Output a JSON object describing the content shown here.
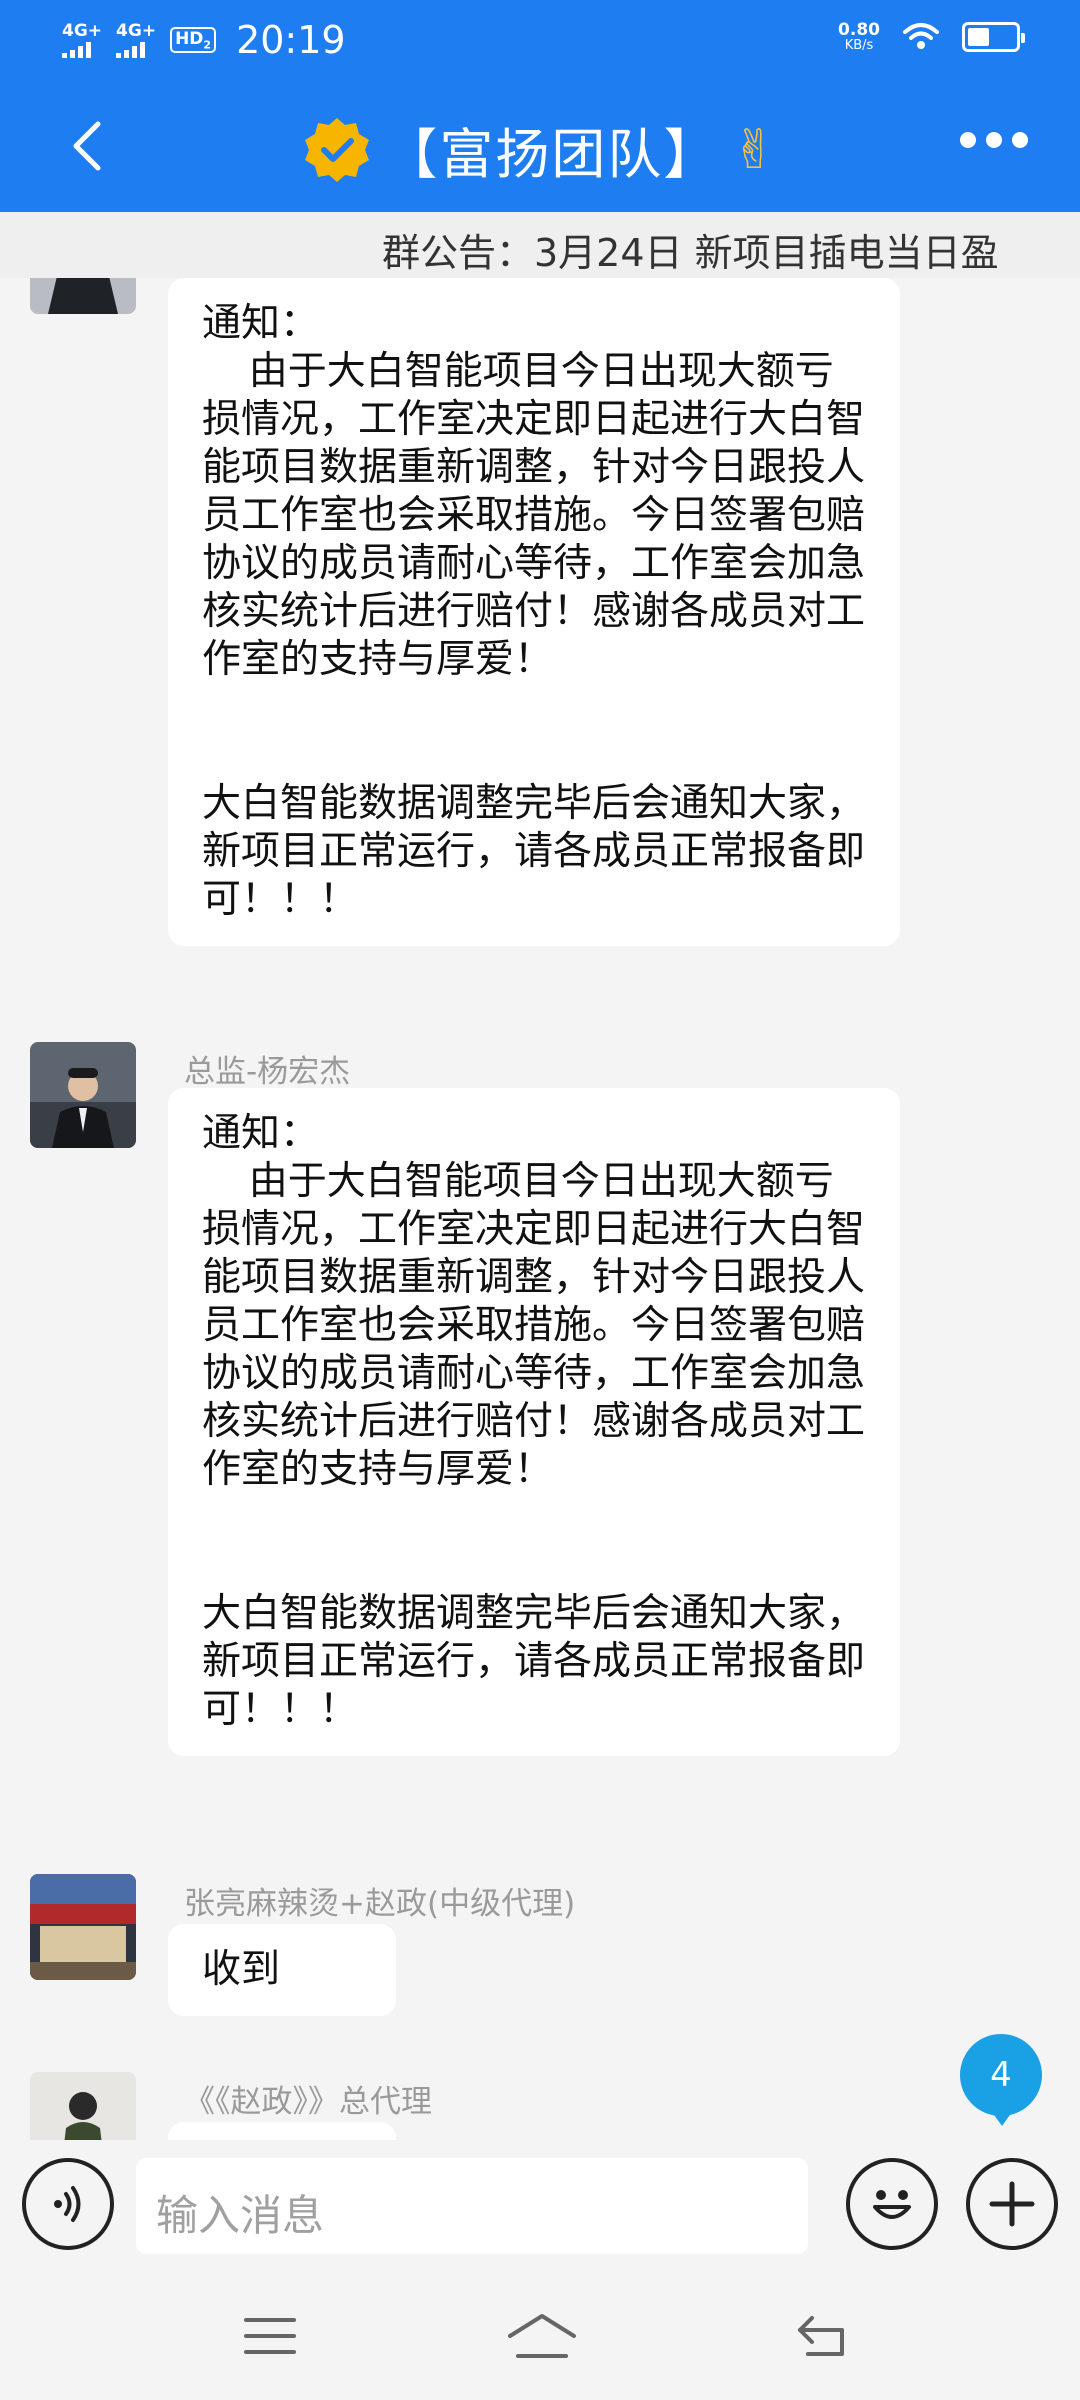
{
  "status_bar": {
    "network1": "4G+",
    "network2": "4G+",
    "hd_label": "HD",
    "hd_sub": "2",
    "time": "20:19",
    "speed_value": "0.80",
    "speed_unit": "KB/s",
    "battery_level": 0.4
  },
  "header": {
    "title": "【富扬团队】",
    "title_emoji": "✌",
    "icons": {
      "back": "back-arrow-icon",
      "badge": "verified-badge-icon",
      "more": "more-dots-icon"
    }
  },
  "announcement": "群公告：3月24日 新项目插电当日盈",
  "messages": [
    {
      "sender": "",
      "lines": [
        "通知：",
        "由于大白智能项目今日出现大额亏损情况，工作室决定即日起进行大白智能项目数据重新调整，针对今日跟投人员工作室也会采取措施。今日签署包赔协议的成员请耐心等待，工作室会加急核实统计后进行赔付！感谢各成员对工作室的支持与厚爱！",
        "大白智能数据调整完毕后会通知大家，新项目正常运行，请各成员正常报备即可！！！"
      ]
    },
    {
      "sender": "总监-杨宏杰",
      "lines": [
        "通知：",
        "由于大白智能项目今日出现大额亏损情况，工作室决定即日起进行大白智能项目数据重新调整，针对今日跟投人员工作室也会采取措施。今日签署包赔协议的成员请耐心等待，工作室会加急核实统计后进行赔付！感谢各成员对工作室的支持与厚爱！",
        "大白智能数据调整完毕后会通知大家，新项目正常运行，请各成员正常报备即可！！！"
      ]
    },
    {
      "sender": "张亮麻辣烫+赵政(中级代理)",
      "lines": [
        "收到"
      ]
    },
    {
      "sender": "《《赵政》》总代理",
      "lines": []
    }
  ],
  "unread_count": "4",
  "input": {
    "placeholder": "输入消息",
    "icons": {
      "voice": "voice-icon",
      "emoji": "emoji-icon",
      "plus": "plus-icon"
    }
  },
  "system_nav": {
    "icons": [
      "menu-icon",
      "home-icon",
      "return-icon"
    ]
  },
  "colors": {
    "accent": "#1e7df0",
    "badge": "#1aa0e4",
    "background": "#f4f4f4"
  }
}
